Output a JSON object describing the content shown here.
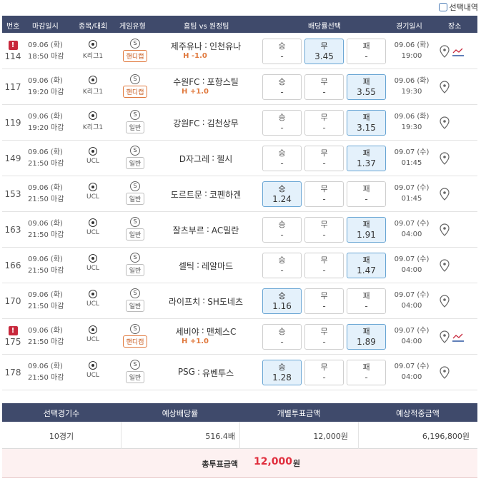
{
  "topbar": {
    "select_history_label": "선택내역"
  },
  "columns": {
    "no": "번호",
    "deadline": "마감일시",
    "sport": "종목/대회",
    "game_type": "게임유형",
    "teams": "홈팀 vs 원정팀",
    "odds": "배당률선택",
    "game_date": "경기일시",
    "venue": "장소"
  },
  "rows": [
    {
      "no": "114",
      "warn": "!",
      "deadline_date": "09.06 (화)",
      "deadline_time": "18:50 마감",
      "league": "K리그1",
      "type_label": "핸디캡",
      "type_icon": "S",
      "home": "제주유나",
      "away": "인천유나",
      "hc": "H -1.0",
      "odds": {
        "win_label": "승",
        "win": "-",
        "draw_label": "무",
        "draw": "3.45",
        "lose_label": "패",
        "lose": "-"
      },
      "game_date": "09.06 (화)",
      "game_time": "19:00"
    },
    {
      "no": "117",
      "warn": "",
      "deadline_date": "09.06 (화)",
      "deadline_time": "19:20 마감",
      "league": "K리그1",
      "type_label": "핸디캡",
      "type_icon": "S",
      "home": "수원FC",
      "away": "포항스틸",
      "hc": "H +1.0",
      "odds": {
        "win_label": "승",
        "win": "-",
        "draw_label": "무",
        "draw": "-",
        "lose_label": "패",
        "lose": "3.55"
      },
      "game_date": "09.06 (화)",
      "game_time": "19:30"
    },
    {
      "no": "119",
      "warn": "",
      "deadline_date": "09.06 (화)",
      "deadline_time": "19:20 마감",
      "league": "K리그1",
      "type_label": "일반",
      "type_icon": "S",
      "home": "강원FC",
      "away": "김천상무",
      "hc": "",
      "odds": {
        "win_label": "승",
        "win": "-",
        "draw_label": "무",
        "draw": "-",
        "lose_label": "패",
        "lose": "3.15"
      },
      "game_date": "09.06 (화)",
      "game_time": "19:30"
    },
    {
      "no": "149",
      "warn": "",
      "deadline_date": "09.06 (화)",
      "deadline_time": "21:50 마감",
      "league": "UCL",
      "type_label": "일반",
      "type_icon": "S",
      "home": "D자그레",
      "away": "첼시",
      "hc": "",
      "odds": {
        "win_label": "승",
        "win": "-",
        "draw_label": "무",
        "draw": "-",
        "lose_label": "패",
        "lose": "1.37"
      },
      "game_date": "09.07 (수)",
      "game_time": "01:45"
    },
    {
      "no": "153",
      "warn": "",
      "deadline_date": "09.06 (화)",
      "deadline_time": "21:50 마감",
      "league": "UCL",
      "type_label": "일반",
      "type_icon": "S",
      "home": "도르트문",
      "away": "코펜하겐",
      "hc": "",
      "odds": {
        "win_label": "승",
        "win": "1.24",
        "draw_label": "무",
        "draw": "-",
        "lose_label": "패",
        "lose": "-"
      },
      "game_date": "09.07 (수)",
      "game_time": "01:45"
    },
    {
      "no": "163",
      "warn": "",
      "deadline_date": "09.06 (화)",
      "deadline_time": "21:50 마감",
      "league": "UCL",
      "type_label": "일반",
      "type_icon": "S",
      "home": "잘츠부르",
      "away": "AC밀란",
      "hc": "",
      "odds": {
        "win_label": "승",
        "win": "-",
        "draw_label": "무",
        "draw": "-",
        "lose_label": "패",
        "lose": "1.91"
      },
      "game_date": "09.07 (수)",
      "game_time": "04:00"
    },
    {
      "no": "166",
      "warn": "",
      "deadline_date": "09.06 (화)",
      "deadline_time": "21:50 마감",
      "league": "UCL",
      "type_label": "일반",
      "type_icon": "S",
      "home": "셀틱",
      "away": "레알마드",
      "hc": "",
      "odds": {
        "win_label": "승",
        "win": "-",
        "draw_label": "무",
        "draw": "-",
        "lose_label": "패",
        "lose": "1.47"
      },
      "game_date": "09.07 (수)",
      "game_time": "04:00"
    },
    {
      "no": "170",
      "warn": "",
      "deadline_date": "09.06 (화)",
      "deadline_time": "21:50 마감",
      "league": "UCL",
      "type_label": "일반",
      "type_icon": "S",
      "home": "라이프치",
      "away": "SH도네츠",
      "hc": "",
      "odds": {
        "win_label": "승",
        "win": "1.16",
        "draw_label": "무",
        "draw": "-",
        "lose_label": "패",
        "lose": "-"
      },
      "game_date": "09.07 (수)",
      "game_time": "04:00"
    },
    {
      "no": "175",
      "warn": "!",
      "deadline_date": "09.06 (화)",
      "deadline_time": "21:50 마감",
      "league": "UCL",
      "type_label": "핸디캡",
      "type_icon": "S",
      "home": "세비야",
      "away": "맨체스C",
      "hc": "H +1.0",
      "odds": {
        "win_label": "승",
        "win": "-",
        "draw_label": "무",
        "draw": "-",
        "lose_label": "패",
        "lose": "1.89"
      },
      "game_date": "09.07 (수)",
      "game_time": "04:00"
    },
    {
      "no": "178",
      "warn": "",
      "deadline_date": "09.06 (화)",
      "deadline_time": "21:50 마감",
      "league": "UCL",
      "type_label": "일반",
      "type_icon": "S",
      "home": "PSG",
      "away": "유벤투스",
      "hc": "",
      "odds": {
        "win_label": "승",
        "win": "1.28",
        "draw_label": "무",
        "draw": "-",
        "lose_label": "패",
        "lose": "-"
      },
      "game_date": "09.07 (수)",
      "game_time": "04:00"
    }
  ],
  "summary": {
    "headers": [
      "선택경기수",
      "예상배당률",
      "개별투표금액",
      "예상적중금액"
    ],
    "values": [
      "10경기",
      "516.4배",
      "12,000원",
      "6,196,800원"
    ],
    "total_label": "총투표금액",
    "total_amount": "12,000",
    "total_unit": "원"
  }
}
